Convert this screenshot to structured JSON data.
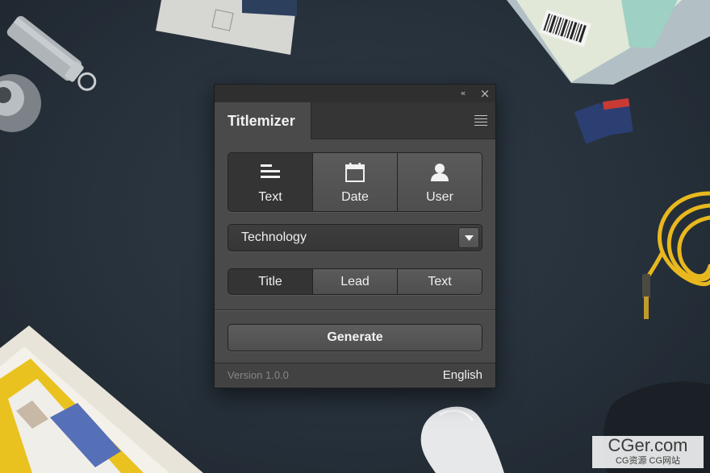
{
  "panel": {
    "collapse_icon": "«",
    "close_icon": "×",
    "tab_title": "Titlemizer",
    "content_types": [
      {
        "label": "Text",
        "icon": "text-lines-icon",
        "selected": true
      },
      {
        "label": "Date",
        "icon": "calendar-icon",
        "selected": false
      },
      {
        "label": "User",
        "icon": "user-icon",
        "selected": false
      }
    ],
    "category": {
      "value": "Technology"
    },
    "text_types": [
      {
        "label": "Title",
        "selected": true
      },
      {
        "label": "Lead",
        "selected": false
      },
      {
        "label": "Text",
        "selected": false
      }
    ],
    "generate_label": "Generate",
    "version": "Version 1.0.0",
    "language": "English"
  },
  "watermark": {
    "line1": "CGer.com",
    "line2": "CG资源 CG网站"
  },
  "colors": {
    "background": "#27313b",
    "panel": "#4a4a4a",
    "selected_segment": "#343434",
    "cable": "#e8b81e"
  }
}
